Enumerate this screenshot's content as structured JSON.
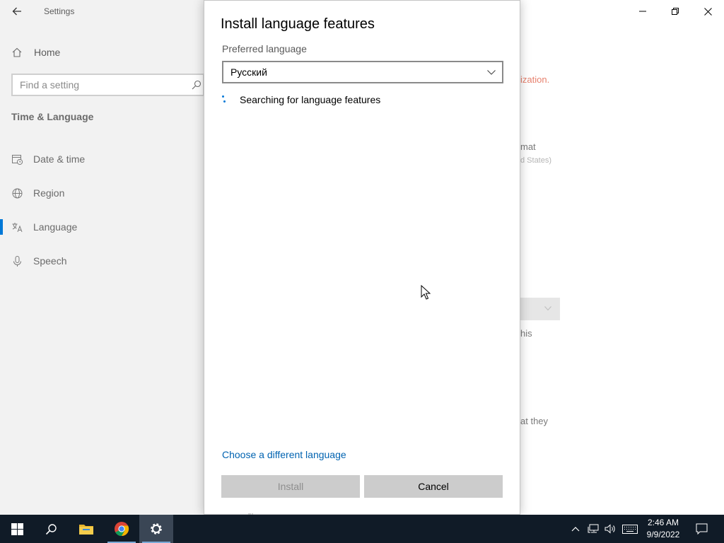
{
  "settings_window": {
    "app_title": "Settings",
    "nav": {
      "home_label": "Home",
      "search_placeholder": "Find a setting",
      "section_title": "Time & Language",
      "items": [
        {
          "label": "Date & time",
          "icon": "calendar-clock-icon"
        },
        {
          "label": "Region",
          "icon": "globe-icon"
        },
        {
          "label": "Language",
          "icon": "language-icon",
          "selected": true
        },
        {
          "label": "Speech",
          "icon": "microphone-icon"
        }
      ]
    },
    "content_fragments": {
      "warning_fragment": "ization.",
      "format_fragment": "mat",
      "format_sub_fragment": "d States)",
      "this_fragment": "his",
      "they_fragment": "at they"
    },
    "window_controls": [
      "minimize",
      "restore",
      "close"
    ]
  },
  "dialog": {
    "title": "Install language features",
    "preferred_language_label": "Preferred language",
    "selected_language": "Русский",
    "status_text": "Searching for language features",
    "different_language_link": "Choose a different language",
    "install_label": "Install",
    "cancel_label": "Cancel",
    "install_enabled": false
  },
  "taskbar": {
    "pinned": [
      "start-icon",
      "search-icon",
      "file-explorer-icon",
      "chrome-icon",
      "settings-icon"
    ],
    "active_app": "Settings",
    "tray_icons": [
      "chevron-up-icon",
      "network-icon",
      "volume-icon",
      "keyboard-icon"
    ],
    "time": "2:46 AM",
    "date": "9/9/2022",
    "notification_icon": "action-center-icon"
  },
  "colors": {
    "accent": "#0078d7",
    "link": "#0063b1",
    "taskbar": "#101b27",
    "nav_bg": "#f2f2f2"
  }
}
